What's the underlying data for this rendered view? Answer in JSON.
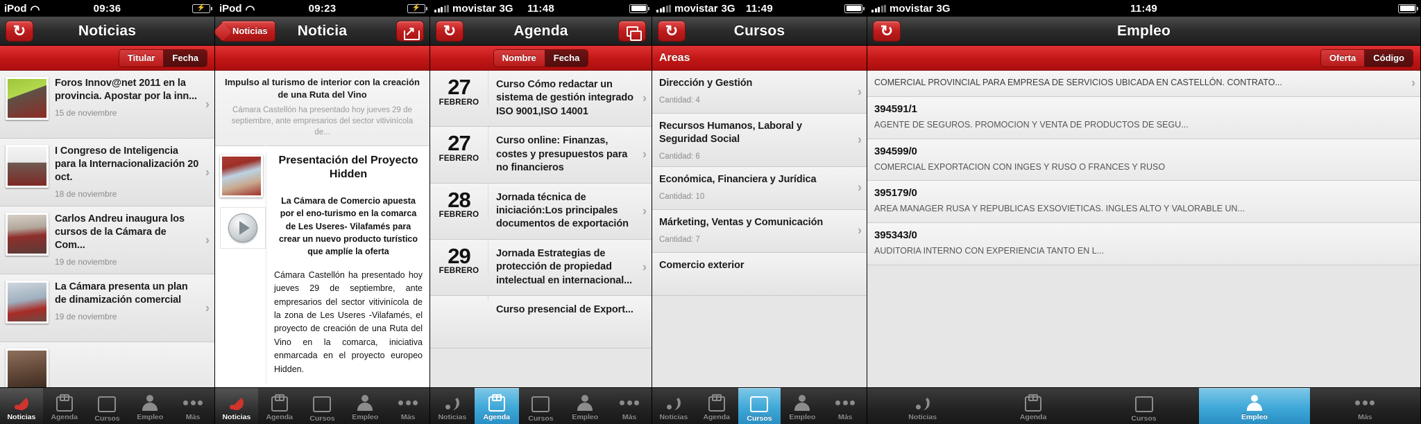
{
  "tabbar": {
    "items": [
      {
        "label": "Noticias",
        "icon": "rss-icon"
      },
      {
        "label": "Agenda",
        "icon": "calendar-icon"
      },
      {
        "label": "Cursos",
        "icon": "book-icon"
      },
      {
        "label": "Empleo",
        "icon": "person-icon"
      },
      {
        "label": "Más",
        "icon": "ellipsis-icon"
      }
    ]
  },
  "panels": [
    {
      "status": {
        "carrier": "iPod",
        "time": "09:36",
        "network": "",
        "signal": "wifi",
        "battery": "charging"
      },
      "nav": {
        "title": "Noticias",
        "left_icon": "refresh-icon",
        "right_icon": ""
      },
      "segments": {
        "items": [
          "Titular",
          "Fecha"
        ],
        "selected": "Fecha"
      },
      "active_tab": "Noticias",
      "rows": [
        {
          "title": "Foros Innov@net 2011 en la provincia. Apostar por la inn...",
          "date": "15 de noviembre",
          "thumb": "t1"
        },
        {
          "title": "I Congreso de Inteligencia para la Internacionalización 20 oct.",
          "date": "18 de noviembre",
          "thumb": "t2"
        },
        {
          "title": "Carlos Andreu inaugura los cursos de la Cámara de Com...",
          "date": "19 de noviembre",
          "thumb": "t3"
        },
        {
          "title": "La Cámara presenta un plan de dinamización comercial",
          "date": "19 de noviembre",
          "thumb": "t4"
        }
      ]
    },
    {
      "status": {
        "carrier": "iPod",
        "time": "09:23",
        "network": "",
        "signal": "wifi",
        "battery": "charging"
      },
      "nav": {
        "title": "Noticia",
        "back_label": "Noticias",
        "right_icon": "share-icon"
      },
      "active_tab": "Noticias",
      "article": {
        "title": "Impulso al turismo de interior con  la creación de una Ruta del Vino",
        "subtitle": "Cámara Castellón ha presentado hoy jueves 29 de septiembre, ante empresarios del sector vitivinícola de...",
        "heading": "Presentación del Proyecto Hidden",
        "lead": "La Cámara de Comercio apuesta por el eno-turismo en la comarca de Les Useres- Vilafamés para crear un nuevo producto turístico que amplíe la oferta",
        "paragraph": "Cámara Castellón ha presentado hoy jueves 29 de septiembre, ante empresarios del sector vitivinícola de la zona de Les Useres -Vilafamés, el proyecto de creación de una Ruta del Vino en la comarca, iniciativa enmarcada en el proyecto europeo Hidden.",
        "photo_icon": "article-photo",
        "video_icon": "play-icon"
      }
    },
    {
      "status": {
        "carrier": "movistar",
        "time": "11:48",
        "network": "3G",
        "signal": "bars",
        "battery": "full"
      },
      "nav": {
        "title": "Agenda",
        "left_icon": "refresh-icon",
        "right_icon": "copy-icon"
      },
      "segments": {
        "items": [
          "Nombre",
          "Fecha"
        ],
        "selected": "Fecha"
      },
      "active_tab": "Agenda",
      "rows": [
        {
          "day": "27",
          "month": "FEBRERO",
          "title": "Curso Cómo redactar un sistema de gestión integrado ISO 9001,ISO 14001"
        },
        {
          "day": "27",
          "month": "FEBRERO",
          "title": "Curso online: Finanzas, costes y presupuestos para no financieros"
        },
        {
          "day": "28",
          "month": "FEBRERO",
          "title": "Jornada técnica de iniciación:Los principales documentos de exportación"
        },
        {
          "day": "29",
          "month": "FEBRERO",
          "title": "Jornada Estrategias de protección de propiedad intelectual en internacional..."
        },
        {
          "day": "",
          "month": "",
          "title": "Curso presencial de Export..."
        }
      ]
    },
    {
      "status": {
        "carrier": "movistar",
        "time": "11:49",
        "network": "3G",
        "signal": "bars",
        "battery": "full"
      },
      "nav": {
        "title": "Cursos",
        "left_icon": "refresh-icon",
        "right_icon": ""
      },
      "subbar_label": "Areas",
      "active_tab": "Cursos",
      "rows": [
        {
          "name": "Dirección y Gestión",
          "qty": "Cantidad: 4"
        },
        {
          "name": "Recursos Humanos, Laboral y Seguridad Social",
          "qty": "Cantidad: 6"
        },
        {
          "name": "Económica, Financiera y Jurídica",
          "qty": "Cantidad: 10"
        },
        {
          "name": "Márketing, Ventas y Comunicación",
          "qty": "Cantidad: 7"
        },
        {
          "name": "Comercio exterior",
          "qty": ""
        }
      ]
    },
    {
      "status": {
        "carrier": "movistar",
        "time": "11:49",
        "network": "3G",
        "signal": "bars",
        "battery": "full"
      },
      "nav": {
        "title": "Empleo",
        "left_icon": "refresh-icon",
        "right_icon": ""
      },
      "segments": {
        "items": [
          "Oferta",
          "Código"
        ],
        "selected": "Código"
      },
      "active_tab": "Empleo",
      "rows": [
        {
          "code": "",
          "desc": "COMERCIAL PROVINCIAL PARA EMPRESA DE SERVICIOS UBICADA EN CASTELLÓN. CONTRATO..."
        },
        {
          "code": "394591/1",
          "desc": "AGENTE DE SEGUROS. PROMOCION Y VENTA DE PRODUCTOS DE SEGU..."
        },
        {
          "code": "394599/0",
          "desc": "COMERCIAL EXPORTACION CON INGES Y RUSO O FRANCES Y RUSO"
        },
        {
          "code": "395179/0",
          "desc": "AREA MANAGER RUSA Y REPUBLICAS EXSOVIETICAS. INGLES ALTO Y VALORABLE UN..."
        },
        {
          "code": "395343/0",
          "desc": "AUDITORIA INTERNO CON EXPERIENCIA TANTO EN L..."
        }
      ]
    }
  ]
}
